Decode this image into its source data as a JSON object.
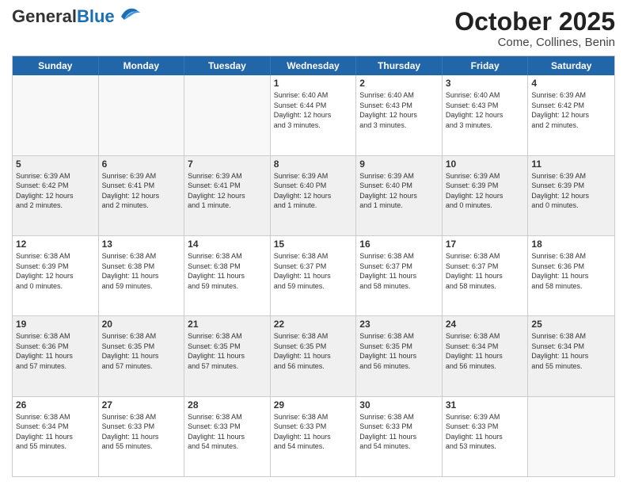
{
  "header": {
    "logo_line1": "General",
    "logo_line2": "Blue",
    "title": "October 2025",
    "subtitle": "Come, Collines, Benin"
  },
  "days": [
    "Sunday",
    "Monday",
    "Tuesday",
    "Wednesday",
    "Thursday",
    "Friday",
    "Saturday"
  ],
  "rows": [
    [
      {
        "num": "",
        "lines": []
      },
      {
        "num": "",
        "lines": []
      },
      {
        "num": "",
        "lines": []
      },
      {
        "num": "1",
        "lines": [
          "Sunrise: 6:40 AM",
          "Sunset: 6:44 PM",
          "Daylight: 12 hours",
          "and 3 minutes."
        ]
      },
      {
        "num": "2",
        "lines": [
          "Sunrise: 6:40 AM",
          "Sunset: 6:43 PM",
          "Daylight: 12 hours",
          "and 3 minutes."
        ]
      },
      {
        "num": "3",
        "lines": [
          "Sunrise: 6:40 AM",
          "Sunset: 6:43 PM",
          "Daylight: 12 hours",
          "and 3 minutes."
        ]
      },
      {
        "num": "4",
        "lines": [
          "Sunrise: 6:39 AM",
          "Sunset: 6:42 PM",
          "Daylight: 12 hours",
          "and 2 minutes."
        ]
      }
    ],
    [
      {
        "num": "5",
        "lines": [
          "Sunrise: 6:39 AM",
          "Sunset: 6:42 PM",
          "Daylight: 12 hours",
          "and 2 minutes."
        ]
      },
      {
        "num": "6",
        "lines": [
          "Sunrise: 6:39 AM",
          "Sunset: 6:41 PM",
          "Daylight: 12 hours",
          "and 2 minutes."
        ]
      },
      {
        "num": "7",
        "lines": [
          "Sunrise: 6:39 AM",
          "Sunset: 6:41 PM",
          "Daylight: 12 hours",
          "and 1 minute."
        ]
      },
      {
        "num": "8",
        "lines": [
          "Sunrise: 6:39 AM",
          "Sunset: 6:40 PM",
          "Daylight: 12 hours",
          "and 1 minute."
        ]
      },
      {
        "num": "9",
        "lines": [
          "Sunrise: 6:39 AM",
          "Sunset: 6:40 PM",
          "Daylight: 12 hours",
          "and 1 minute."
        ]
      },
      {
        "num": "10",
        "lines": [
          "Sunrise: 6:39 AM",
          "Sunset: 6:39 PM",
          "Daylight: 12 hours",
          "and 0 minutes."
        ]
      },
      {
        "num": "11",
        "lines": [
          "Sunrise: 6:39 AM",
          "Sunset: 6:39 PM",
          "Daylight: 12 hours",
          "and 0 minutes."
        ]
      }
    ],
    [
      {
        "num": "12",
        "lines": [
          "Sunrise: 6:38 AM",
          "Sunset: 6:39 PM",
          "Daylight: 12 hours",
          "and 0 minutes."
        ]
      },
      {
        "num": "13",
        "lines": [
          "Sunrise: 6:38 AM",
          "Sunset: 6:38 PM",
          "Daylight: 11 hours",
          "and 59 minutes."
        ]
      },
      {
        "num": "14",
        "lines": [
          "Sunrise: 6:38 AM",
          "Sunset: 6:38 PM",
          "Daylight: 11 hours",
          "and 59 minutes."
        ]
      },
      {
        "num": "15",
        "lines": [
          "Sunrise: 6:38 AM",
          "Sunset: 6:37 PM",
          "Daylight: 11 hours",
          "and 59 minutes."
        ]
      },
      {
        "num": "16",
        "lines": [
          "Sunrise: 6:38 AM",
          "Sunset: 6:37 PM",
          "Daylight: 11 hours",
          "and 58 minutes."
        ]
      },
      {
        "num": "17",
        "lines": [
          "Sunrise: 6:38 AM",
          "Sunset: 6:37 PM",
          "Daylight: 11 hours",
          "and 58 minutes."
        ]
      },
      {
        "num": "18",
        "lines": [
          "Sunrise: 6:38 AM",
          "Sunset: 6:36 PM",
          "Daylight: 11 hours",
          "and 58 minutes."
        ]
      }
    ],
    [
      {
        "num": "19",
        "lines": [
          "Sunrise: 6:38 AM",
          "Sunset: 6:36 PM",
          "Daylight: 11 hours",
          "and 57 minutes."
        ]
      },
      {
        "num": "20",
        "lines": [
          "Sunrise: 6:38 AM",
          "Sunset: 6:35 PM",
          "Daylight: 11 hours",
          "and 57 minutes."
        ]
      },
      {
        "num": "21",
        "lines": [
          "Sunrise: 6:38 AM",
          "Sunset: 6:35 PM",
          "Daylight: 11 hours",
          "and 57 minutes."
        ]
      },
      {
        "num": "22",
        "lines": [
          "Sunrise: 6:38 AM",
          "Sunset: 6:35 PM",
          "Daylight: 11 hours",
          "and 56 minutes."
        ]
      },
      {
        "num": "23",
        "lines": [
          "Sunrise: 6:38 AM",
          "Sunset: 6:35 PM",
          "Daylight: 11 hours",
          "and 56 minutes."
        ]
      },
      {
        "num": "24",
        "lines": [
          "Sunrise: 6:38 AM",
          "Sunset: 6:34 PM",
          "Daylight: 11 hours",
          "and 56 minutes."
        ]
      },
      {
        "num": "25",
        "lines": [
          "Sunrise: 6:38 AM",
          "Sunset: 6:34 PM",
          "Daylight: 11 hours",
          "and 55 minutes."
        ]
      }
    ],
    [
      {
        "num": "26",
        "lines": [
          "Sunrise: 6:38 AM",
          "Sunset: 6:34 PM",
          "Daylight: 11 hours",
          "and 55 minutes."
        ]
      },
      {
        "num": "27",
        "lines": [
          "Sunrise: 6:38 AM",
          "Sunset: 6:33 PM",
          "Daylight: 11 hours",
          "and 55 minutes."
        ]
      },
      {
        "num": "28",
        "lines": [
          "Sunrise: 6:38 AM",
          "Sunset: 6:33 PM",
          "Daylight: 11 hours",
          "and 54 minutes."
        ]
      },
      {
        "num": "29",
        "lines": [
          "Sunrise: 6:38 AM",
          "Sunset: 6:33 PM",
          "Daylight: 11 hours",
          "and 54 minutes."
        ]
      },
      {
        "num": "30",
        "lines": [
          "Sunrise: 6:38 AM",
          "Sunset: 6:33 PM",
          "Daylight: 11 hours",
          "and 54 minutes."
        ]
      },
      {
        "num": "31",
        "lines": [
          "Sunrise: 6:39 AM",
          "Sunset: 6:33 PM",
          "Daylight: 11 hours",
          "and 53 minutes."
        ]
      },
      {
        "num": "",
        "lines": []
      }
    ]
  ]
}
